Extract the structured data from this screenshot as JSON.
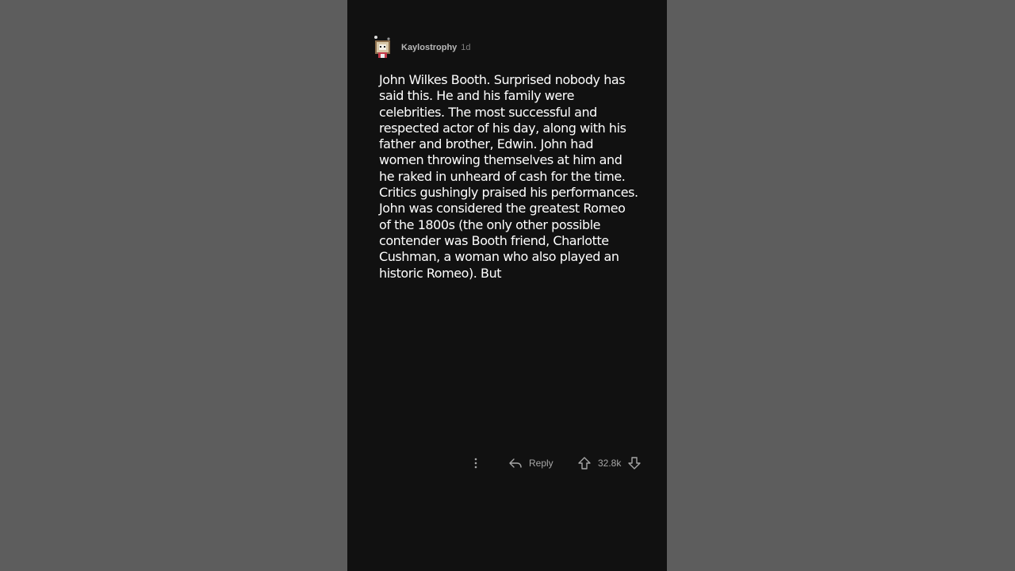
{
  "comment": {
    "username": "Kaylostrophy",
    "age": "1d",
    "avatar_icon": "avatar-icon",
    "body": "John Wilkes Booth. Surprised nobody has said this. He and his family were celebrities. The most successful and respected actor of his day, along with his father and brother, Edwin. John had women throwing themselves at him and he raked in unheard of cash for the time. Critics gushingly praised his performances. John was considered the greatest Romeo of the 1800s (the only other possible contender was Booth friend, Charlotte Cushman, a woman who also played an historic Romeo). But"
  },
  "actions": {
    "more_icon": "more-vertical-icon",
    "reply_icon": "reply-arrow-icon",
    "reply_label": "Reply",
    "upvote_icon": "upvote-arrow-icon",
    "score": "32.8k",
    "downvote_icon": "downvote-arrow-icon"
  },
  "colors": {
    "panel_background": "#111111",
    "side_background": "#5d5d5d",
    "body_text": "#ffffff",
    "muted_text": "#a7a7a7"
  }
}
